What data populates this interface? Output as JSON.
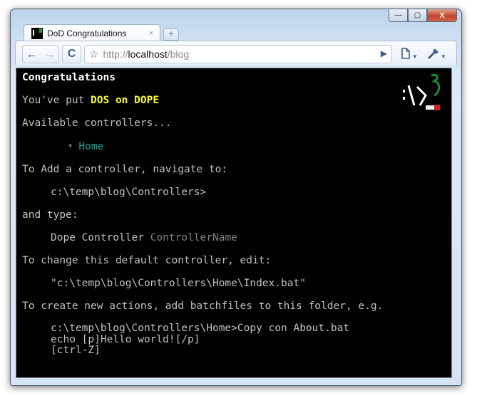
{
  "window": {
    "controls": {
      "minimize": "—",
      "maximize": "▢",
      "close": "X"
    }
  },
  "tab": {
    "title": "DoD Congratulations",
    "close_glyph": "×",
    "new_tab_glyph": "+"
  },
  "toolbar": {
    "back_icon": "←",
    "forward_icon": "→",
    "reload_icon": "C",
    "star_icon": "☆",
    "url_scheme": "http://",
    "url_host": "localhost",
    "url_path": "/blog",
    "go_icon": "▶",
    "page_menu_icon": "page-icon",
    "tools_menu_icon": "wrench-icon"
  },
  "page": {
    "heading": "Congratulations",
    "intro_prefix": "You've put ",
    "intro_highlight": "DOS on DOPE",
    "available_label": "Available controllers...",
    "controllers": [
      {
        "bullet": "*",
        "label": "Home"
      }
    ],
    "add_instruction": "To Add a controller, navigate to:",
    "add_path": "c:\\temp\\blog\\Controllers>",
    "and_type": "and type:",
    "command_prefix": "Dope Controller ",
    "command_placeholder": "ControllerName",
    "change_instruction": "To change this default controller, edit:",
    "default_file": "\"c:\\temp\\blog\\Controllers\\Home\\Index.bat\"",
    "actions_instruction": "To create new actions, add batchfiles to this folder, e.g.",
    "example_lines": [
      "c:\\temp\\blog\\Controllers\\Home>Copy con About.bat",
      "echo [p]Hello world![/p]",
      "[ctrl-Z]"
    ]
  },
  "colors": {
    "highlight": "#ffff00",
    "link": "#1aa0a0",
    "background": "#000000",
    "text": "#c0c0c0"
  }
}
